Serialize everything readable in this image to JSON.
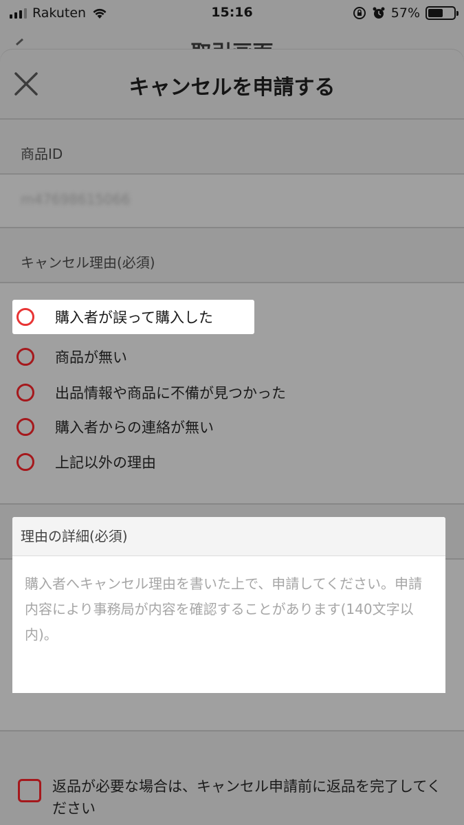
{
  "status_bar": {
    "carrier": "Rakuten",
    "time": "15:16",
    "battery": "57%",
    "battery_level": 0.57
  },
  "behind": {
    "title": "取引画面"
  },
  "sheet": {
    "title": "キャンセルを申請する",
    "product_id_label": "商品ID",
    "product_id_value": "m47698615066",
    "reason_label": "キャンセル理由(必須)",
    "reasons": [
      {
        "label": "購入者が誤って購入した",
        "selected": true
      },
      {
        "label": "商品が無い",
        "selected": false
      },
      {
        "label": "出品情報や商品に不備が見つかった",
        "selected": false
      },
      {
        "label": "購入者からの連絡が無い",
        "selected": false
      },
      {
        "label": "上記以外の理由",
        "selected": false
      }
    ],
    "detail_label": "理由の詳細(必須)",
    "detail_placeholder": "購入者へキャンセル理由を書いた上で、申請してください。申請内容により事務局が内容を確認することがあります(140文字以内)。",
    "return_checkbox_label": "返品が必要な場合は、キャンセル申請前に返品を完了してください"
  },
  "colors": {
    "accent": "#a5181c",
    "accent_active": "#e83434",
    "overlay": "#9a9a9a"
  }
}
